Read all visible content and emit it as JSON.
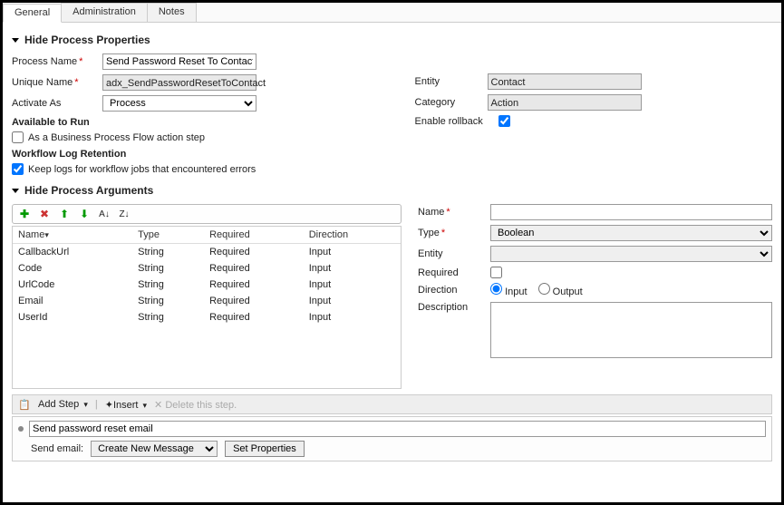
{
  "tabs": {
    "general": "General",
    "administration": "Administration",
    "notes": "Notes"
  },
  "sections": {
    "hideProps": "Hide Process Properties",
    "hideArgs": "Hide Process Arguments"
  },
  "props": {
    "labels": {
      "processName": "Process Name",
      "uniqueName": "Unique Name",
      "activateAs": "Activate As",
      "entity": "Entity",
      "category": "Category",
      "enableRollback": "Enable rollback",
      "availableToRun": "Available to Run",
      "bpfStep": "As a Business Process Flow action step",
      "logRetention": "Workflow Log Retention",
      "keepLogs": "Keep logs for workflow jobs that encountered errors"
    },
    "values": {
      "processName": "Send Password Reset To Contact",
      "uniqueName": "adx_SendPasswordResetToContact",
      "activateAs": "Process",
      "entity": "Contact",
      "category": "Action"
    }
  },
  "argsGrid": {
    "headers": {
      "name": "Name",
      "type": "Type",
      "required": "Required",
      "direction": "Direction"
    },
    "rows": [
      {
        "name": "CallbackUrl",
        "type": "String",
        "required": "Required",
        "direction": "Input"
      },
      {
        "name": "Code",
        "type": "String",
        "required": "Required",
        "direction": "Input"
      },
      {
        "name": "UrlCode",
        "type": "String",
        "required": "Required",
        "direction": "Input"
      },
      {
        "name": "Email",
        "type": "String",
        "required": "Required",
        "direction": "Input"
      },
      {
        "name": "UserId",
        "type": "String",
        "required": "Required",
        "direction": "Input"
      }
    ]
  },
  "argForm": {
    "labels": {
      "name": "Name",
      "type": "Type",
      "entity": "Entity",
      "required": "Required",
      "direction": "Direction",
      "input": "Input",
      "output": "Output",
      "description": "Description"
    },
    "values": {
      "type": "Boolean"
    }
  },
  "stepBar": {
    "addStep": "Add Step",
    "insert": "Insert",
    "delete": "Delete this step."
  },
  "step": {
    "title": "Send password reset email",
    "sendEmailLabel": "Send email:",
    "sendEmailValue": "Create New Message",
    "setProperties": "Set Properties"
  }
}
